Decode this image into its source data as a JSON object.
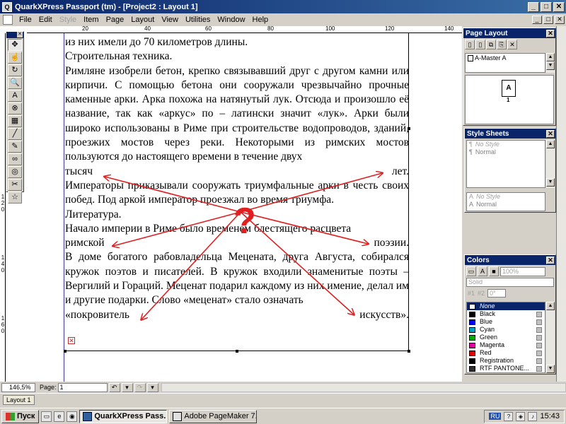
{
  "window": {
    "title": "QuarkXPress Passport (tm) - [Project2 : Layout 1]",
    "minimize": "_",
    "maximize": "□",
    "close": "✕"
  },
  "menu": {
    "items": [
      "File",
      "Edit",
      "Style",
      "Item",
      "Page",
      "Layout",
      "View",
      "Utilities",
      "Window",
      "Help"
    ],
    "disabled": [
      false,
      false,
      true,
      false,
      false,
      false,
      false,
      false,
      false,
      false
    ]
  },
  "ruler": {
    "top_labels": [
      "20",
      "40",
      "60",
      "80",
      "100",
      "120",
      "140"
    ],
    "left_labels": [
      "1",
      "2",
      "0",
      "1",
      "4",
      "0",
      "1",
      "6",
      "0"
    ]
  },
  "document": {
    "lines": [
      {
        "type": "line",
        "text": "из них имели до 70 километров длины."
      },
      {
        "type": "line",
        "text": "Строительная техника."
      },
      {
        "type": "para",
        "text": "Римляне изобрели бетон, крепко связывавший друг с другом камни или кирпичи. С помощью бетона они сооружали чрезвычайно прочные каменные арки. Арка похожа на натянутый лук. Отсюда и произошло её название, так как «аркус» по – латински значит «лук». Арки были широко использованы в Риме при строительстве водопроводов, зданий, проезжих мостов через реки. Некоторыми из римских мостов пользуются до настоящего времени в течение двух"
      },
      {
        "type": "spread",
        "left": "тысяч",
        "right": "лет."
      },
      {
        "type": "para",
        "text": "Императоры приказывали сооружать триумфальные арки в честь своих побед. Под аркой император проезжал во время триумфа."
      },
      {
        "type": "line",
        "text": "Литература."
      },
      {
        "type": "para",
        "text": "Начало империи в Риме было временем блестящего расцвета"
      },
      {
        "type": "spread",
        "left": "римской",
        "right": "поэзии."
      },
      {
        "type": "para",
        "text": "В доме богатого рабовладельца Мецената, друга Августа, собирался кружок поэтов и писателей. В кружок входили знаменитые поэты – Вергилий и Гораций. Меценат подарил каждому из них имение, делал им и другие подарки. Слово «меценат» стало означать"
      },
      {
        "type": "spread",
        "left": "«покровитель",
        "right": "искусств»."
      }
    ],
    "overlay_symbol": "?",
    "overlay_color": "#e02020"
  },
  "tools": [
    "✥",
    "☝",
    "↻",
    "🔍",
    "A",
    "⊗",
    "▦",
    "╱",
    "✎",
    "∞",
    "◎",
    "✂",
    "☆"
  ],
  "page_layout": {
    "title": "Page Layout",
    "master": "A-Master A",
    "page_letter": "A",
    "page_number": "1"
  },
  "style_sheets": {
    "title": "Style Sheets",
    "paragraph_styles": [
      {
        "icon": "¶",
        "name": "No Style"
      },
      {
        "icon": "¶",
        "name": "Normal"
      }
    ],
    "character_styles": [
      {
        "icon": "A",
        "name": "No Style"
      },
      {
        "icon": "A",
        "name": "Normal"
      }
    ]
  },
  "colors": {
    "title": "Colors",
    "shade": "100%",
    "blend": "Solid",
    "angle": "0°",
    "radio_1": "#1",
    "radio_2": "#2",
    "items": [
      {
        "name": "None",
        "hex": "#ffffff",
        "selected": true
      },
      {
        "name": "Black",
        "hex": "#000000"
      },
      {
        "name": "Blue",
        "hex": "#0000ff"
      },
      {
        "name": "Cyan",
        "hex": "#00a0c0"
      },
      {
        "name": "Green",
        "hex": "#00b000"
      },
      {
        "name": "Magenta",
        "hex": "#e000a0"
      },
      {
        "name": "Red",
        "hex": "#e00000"
      },
      {
        "name": "Registration",
        "hex": "#000000"
      },
      {
        "name": "RTF PANTONE...",
        "hex": "#303030"
      }
    ]
  },
  "status": {
    "zoom": "146,5%",
    "page_label": "Page:",
    "page_value": "1",
    "layout_tab": "Layout 1"
  },
  "taskbar": {
    "start": "Пуск",
    "tasks": [
      {
        "label": "QuarkXPress Pass...",
        "active": true
      },
      {
        "label": "Adobe PageMaker 7....",
        "active": false
      }
    ],
    "lang": "RU",
    "time": "15:43"
  }
}
